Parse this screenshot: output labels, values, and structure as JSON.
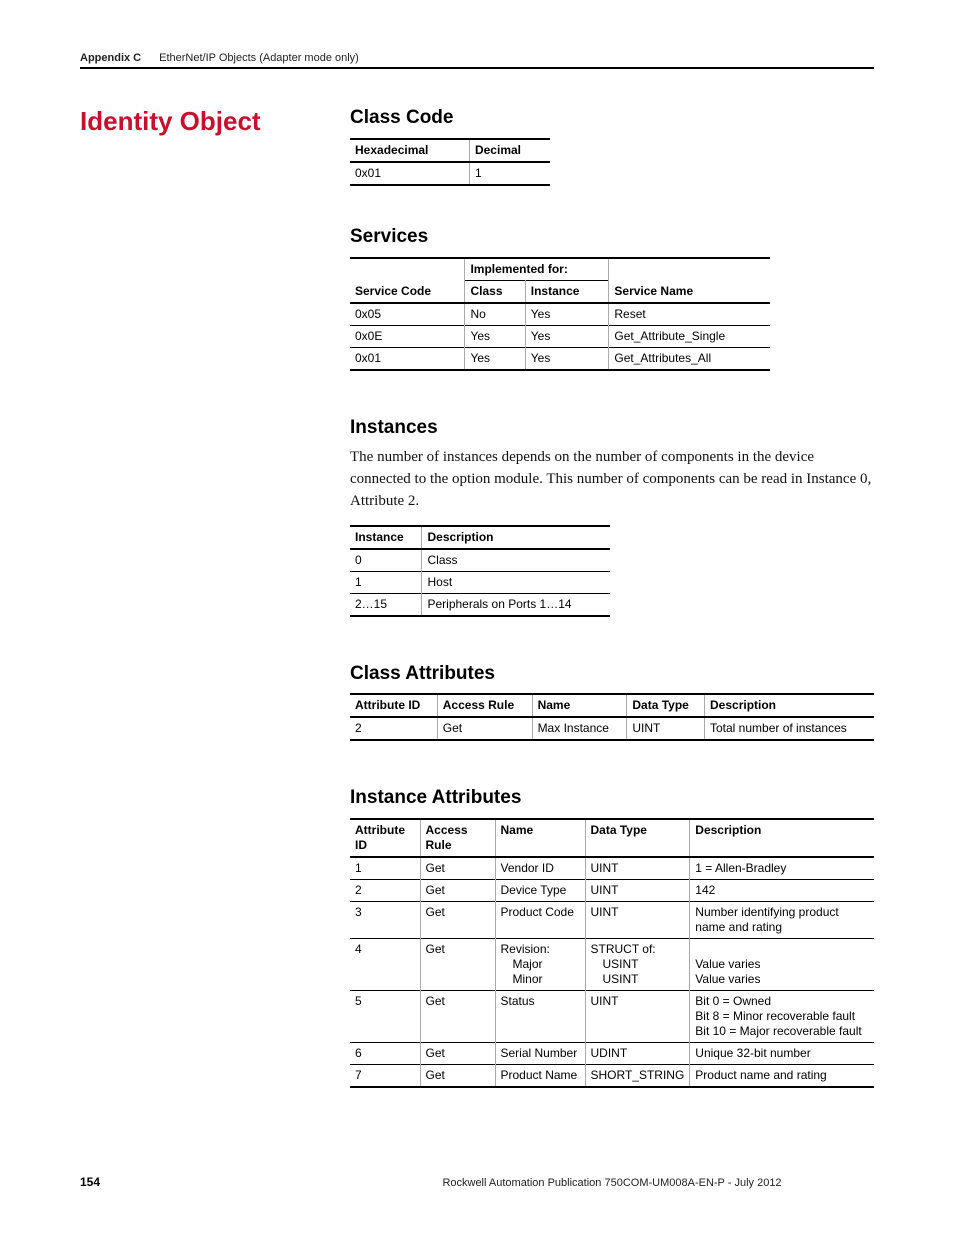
{
  "header": {
    "appendix": "Appendix C",
    "topic": "EtherNet/IP Objects (Adapter mode only)"
  },
  "title": "Identity Object",
  "class_code": {
    "heading": "Class Code",
    "cols": [
      "Hexadecimal",
      "Decimal"
    ],
    "rows": [
      [
        "0x01",
        "1"
      ]
    ]
  },
  "services": {
    "heading": "Services",
    "group_label": "Implemented for:",
    "cols": [
      "Service Code",
      "Class",
      "Instance",
      "Service Name"
    ],
    "rows": [
      [
        "0x05",
        "No",
        "Yes",
        "Reset"
      ],
      [
        "0x0E",
        "Yes",
        "Yes",
        "Get_Attribute_Single"
      ],
      [
        "0x01",
        "Yes",
        "Yes",
        "Get_Attributes_All"
      ]
    ]
  },
  "instances": {
    "heading": "Instances",
    "body": "The number of instances depends on the number of components in the device connected to the option module. This number of components can be read in Instance 0, Attribute 2.",
    "cols": [
      "Instance",
      "Description"
    ],
    "rows": [
      [
        "0",
        "Class"
      ],
      [
        "1",
        "Host"
      ],
      [
        "2…15",
        "Peripherals on Ports 1…14"
      ]
    ]
  },
  "class_attributes": {
    "heading": "Class Attributes",
    "cols": [
      "Attribute ID",
      "Access Rule",
      "Name",
      "Data Type",
      "Description"
    ],
    "rows": [
      [
        "2",
        "Get",
        "Max Instance",
        "UINT",
        "Total number of instances"
      ]
    ]
  },
  "instance_attributes": {
    "heading": "Instance Attributes",
    "cols": [
      "Attribute ID",
      "Access Rule",
      "Name",
      "Data Type",
      "Description"
    ],
    "rows": [
      {
        "id": "1",
        "rule": "Get",
        "name": "Vendor ID",
        "type": "UINT",
        "desc": "1 = Allen-Bradley"
      },
      {
        "id": "2",
        "rule": "Get",
        "name": "Device Type",
        "type": "UINT",
        "desc": "142"
      },
      {
        "id": "3",
        "rule": "Get",
        "name": "Product Code",
        "type": "UINT",
        "desc": "Number identifying product name and rating"
      },
      {
        "id": "4",
        "rule": "Get",
        "name_lines": [
          "Revision:",
          "Major",
          "Minor"
        ],
        "type_lines": [
          "STRUCT of:",
          "USINT",
          "USINT"
        ],
        "desc_lines": [
          "",
          "Value varies",
          "Value varies"
        ]
      },
      {
        "id": "5",
        "rule": "Get",
        "name": "Status",
        "type": "UINT",
        "desc_lines": [
          "Bit 0 = Owned",
          "Bit 8 = Minor recoverable fault",
          "Bit 10 = Major recoverable fault"
        ]
      },
      {
        "id": "6",
        "rule": "Get",
        "name": "Serial Number",
        "type": "UDINT",
        "desc": "Unique 32-bit number"
      },
      {
        "id": "7",
        "rule": "Get",
        "name": "Product Name",
        "type": "SHORT_STRING",
        "desc": "Product name and rating"
      }
    ]
  },
  "footer": {
    "page": "154",
    "pub": "Rockwell Automation Publication 750COM-UM008A-EN-P - July 2012"
  }
}
